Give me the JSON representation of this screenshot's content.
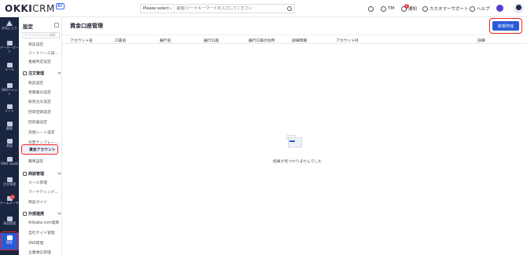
{
  "app": {
    "logo_main": "OKKI",
    "logo_crm": "CRM",
    "logo_ai": "AI"
  },
  "topbar": {
    "search_select": "Please select",
    "search_placeholder": "顧客/リードキーワードを入力してください",
    "team_label": "TM",
    "notify_label": "通知",
    "notify_badge": "5",
    "support_label": "カスタマーサポート",
    "help_label": "ヘルプ"
  },
  "leftnav": {
    "items": [
      {
        "label": "お気に入り",
        "icon": "star-icon"
      },
      {
        "label": "データーボード",
        "icon": "dashboard-icon"
      },
      {
        "label": "メール",
        "icon": "mail-icon"
      },
      {
        "label": "SNSチャット",
        "icon": "chat-icon"
      },
      {
        "label": "リード",
        "icon": "lead-icon"
      },
      {
        "label": "顧客",
        "icon": "customer-icon"
      },
      {
        "label": "商談",
        "icon": "deal-icon"
      },
      {
        "label": "OKKI Leads",
        "icon": "okki-leads-icon"
      },
      {
        "label": "注文管理",
        "icon": "order-icon"
      },
      {
        "label": "チームデータ",
        "icon": "team-data-icon",
        "badge": "4"
      },
      {
        "label": "承認管理",
        "icon": "approval-icon"
      },
      {
        "label": "設定",
        "icon": "settings-icon"
      }
    ]
  },
  "subnav": {
    "title": "設定",
    "search_placeholder": "クイックメニュー検索",
    "items_top": [
      "商談設定",
      "リードソース設...",
      "重複判定設定"
    ],
    "group_order": "注文管理",
    "order_items": [
      "製品設定",
      "見積書の設定",
      "販売注文設定",
      "回収登録設定",
      "回収書設定",
      "為替レート設定",
      "伝票テンプレー..."
    ],
    "active_item": "資金アカウント",
    "after_active": [
      "費用設定"
    ],
    "group_deal": "商談管理",
    "deal_items": [
      "メール管理",
      "マーケティング...",
      "商談ガイド"
    ],
    "group_external": "外部連携",
    "external_items": [
      "Alibaba.com連携",
      "自社サイト管理",
      "SNS管理",
      "企業微信管理"
    ]
  },
  "main": {
    "title": "資金口座管理",
    "new_button": "新規作成",
    "columns": [
      "アカウント名",
      "口座名",
      "銀行名",
      "銀行口座",
      "銀行口座の住所",
      "詳細情報",
      "アカウントId",
      "詳細"
    ],
    "empty_text": "結果が見つかりませんでした"
  }
}
